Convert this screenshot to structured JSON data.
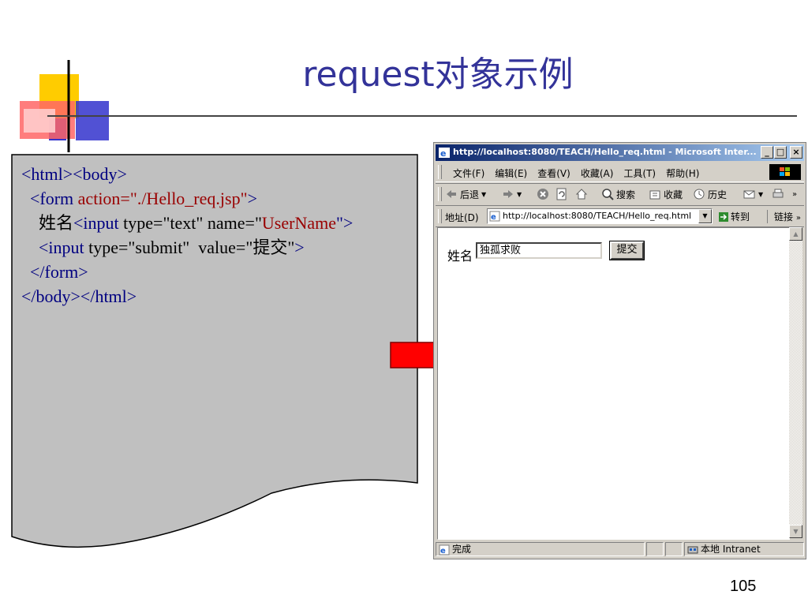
{
  "slide": {
    "title": "request对象示例",
    "page_number": "105"
  },
  "code": {
    "lines": [
      [
        {
          "t": "<html><body>",
          "c": "blue"
        }
      ],
      [
        {
          "t": "  <form ",
          "c": "blue"
        },
        {
          "t": "action=\"./Hello_req.jsp\"",
          "c": "red"
        },
        {
          "t": ">",
          "c": "blue"
        }
      ],
      [
        {
          "t": "    姓名",
          "c": "black"
        },
        {
          "t": "<input ",
          "c": "blue"
        },
        {
          "t": "type=\"text\" name=\"",
          "c": "black"
        },
        {
          "t": "UserName",
          "c": "red"
        },
        {
          "t": "\">",
          "c": "blue"
        }
      ],
      [
        {
          "t": "    <input ",
          "c": "blue"
        },
        {
          "t": "type=\"submit\"  value=\"提交\"",
          "c": "black"
        },
        {
          "t": ">",
          "c": "blue"
        }
      ],
      [
        {
          "t": "  </form>",
          "c": "blue"
        }
      ],
      [
        {
          "t": "</body></html>",
          "c": "blue"
        }
      ]
    ]
  },
  "browser": {
    "title": "http://localhost:8080/TEACH/Hello_req.html - Microsoft Inter...",
    "menu": [
      "文件(F)",
      "编辑(E)",
      "查看(V)",
      "收藏(A)",
      "工具(T)",
      "帮助(H)"
    ],
    "toolbar": {
      "back": "后退",
      "search": "搜索",
      "favorites": "收藏",
      "history": "历史"
    },
    "address_label": "地址(D)",
    "address_url": "http://localhost:8080/TEACH/Hello_req.html",
    "go_label": "转到",
    "links_label": "链接",
    "form": {
      "name_label": "姓名",
      "name_value": "独孤求败",
      "submit_label": "提交"
    },
    "status": {
      "text": "完成",
      "zone": "本地 Intranet"
    }
  },
  "colors": {
    "title": "#333399",
    "code_blue": "#000080",
    "code_red": "#990000",
    "arrow": "#ff0000"
  }
}
